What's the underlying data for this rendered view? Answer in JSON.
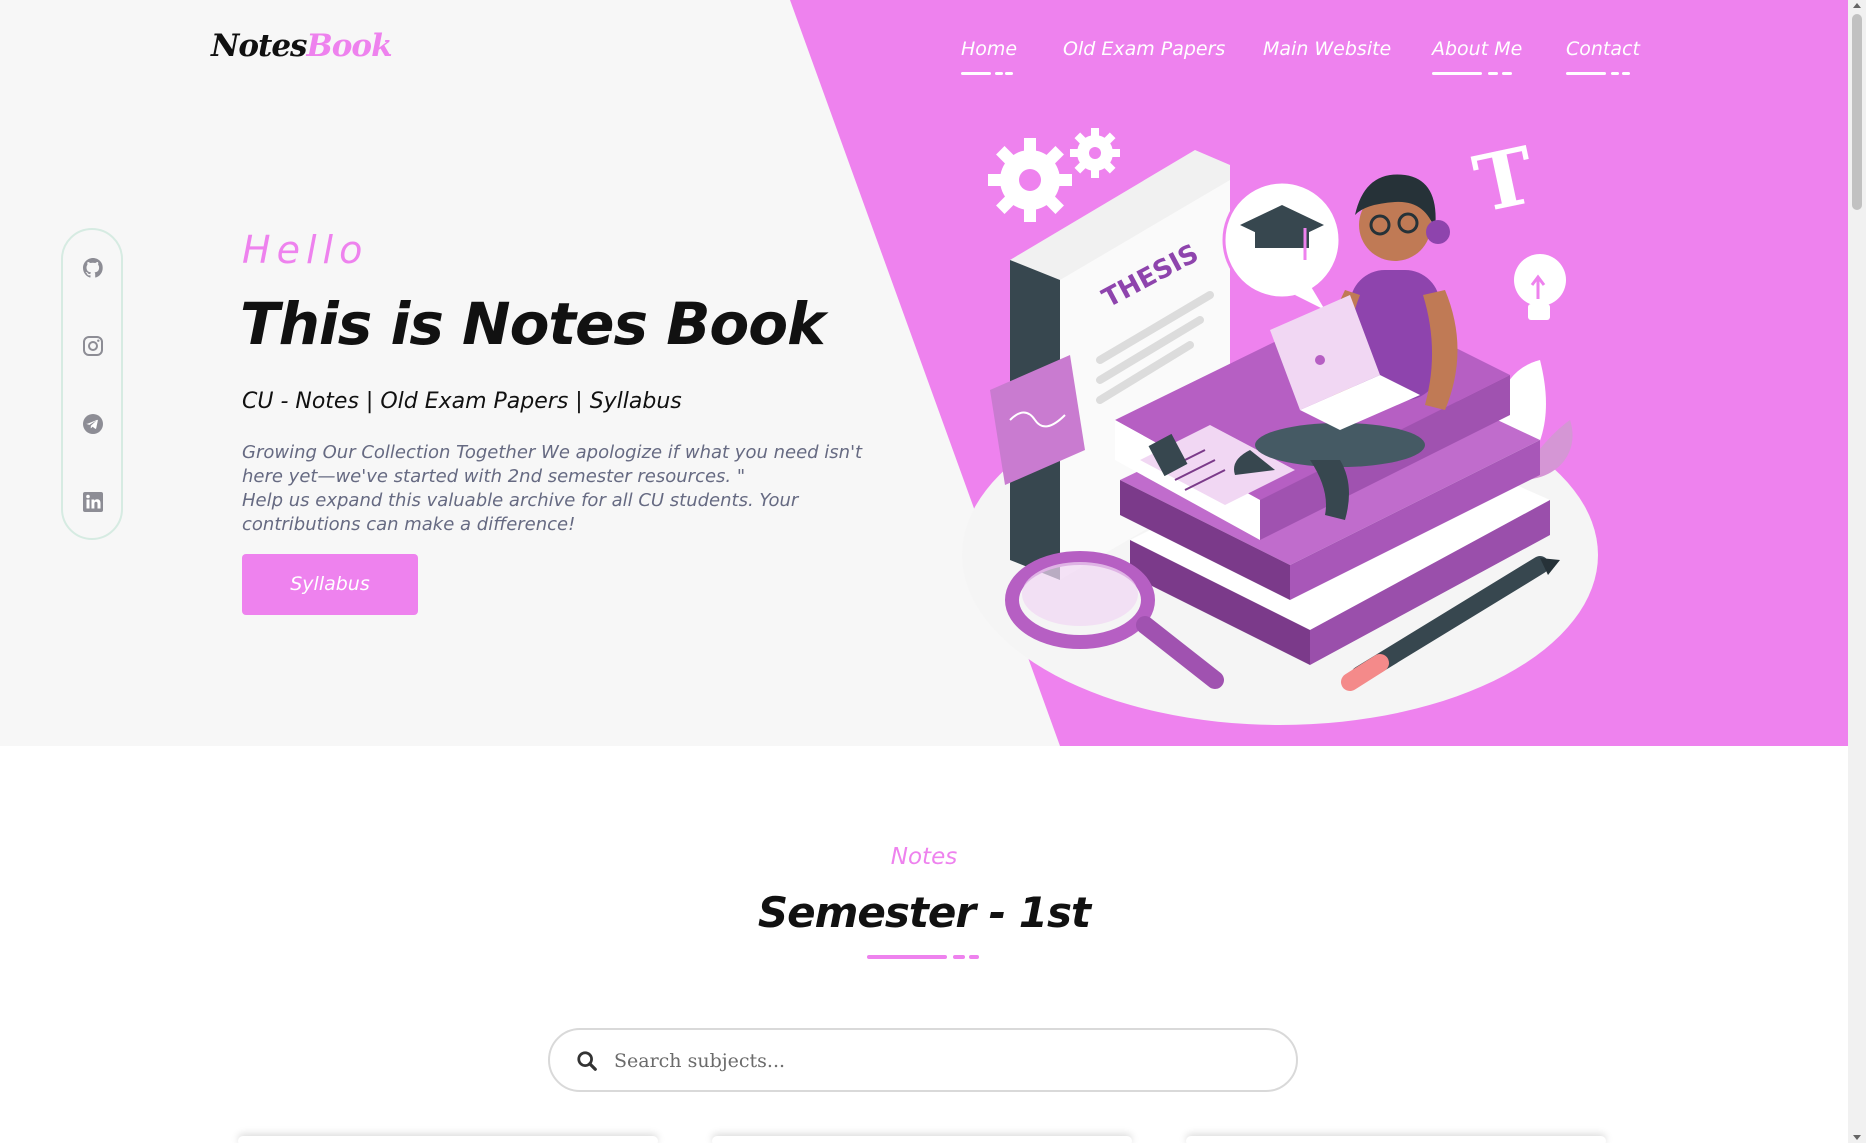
{
  "brand": {
    "logo_part1": "Notes",
    "logo_part2": "Book"
  },
  "nav": {
    "items": [
      {
        "label": "Home"
      },
      {
        "label": "Old Exam Papers"
      },
      {
        "label": "Main Website"
      },
      {
        "label": "About Me"
      },
      {
        "label": "Contact"
      }
    ]
  },
  "social": {
    "icons": [
      "github-icon",
      "instagram-icon",
      "telegram-icon",
      "linkedin-icon"
    ]
  },
  "hero": {
    "greeting": "Hello",
    "title": "This is Notes Book",
    "subtitle": "CU - Notes | Old Exam Papers | Syllabus",
    "description_line1": "Growing Our Collection Together We apologize if what you need isn't here yet—we've started with 2nd semester resources. \"",
    "description_line2": "Help us expand this valuable archive for all CU students. Your contributions can make a difference!",
    "button_label": "Syllabus",
    "illustration_text": "THESIS"
  },
  "notes": {
    "label": "Notes",
    "title": "Semester - 1st"
  },
  "search": {
    "placeholder": "Search subjects..."
  },
  "colors": {
    "accent": "#ee82ee",
    "hero_bg": "#f7f7f7",
    "text_dark": "#111111",
    "text_muted": "#666a82"
  }
}
